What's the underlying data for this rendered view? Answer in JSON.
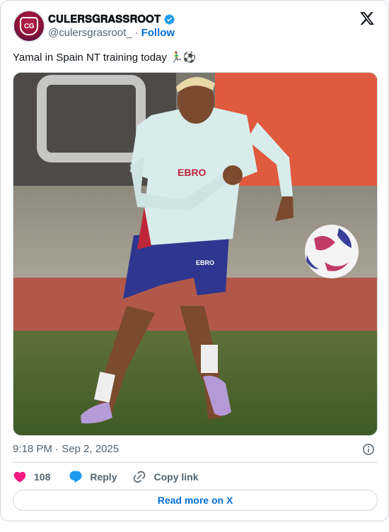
{
  "author": {
    "display_name": "𝐂𝐔𝐋𝐄𝐑𝐒𝐆𝐑𝐀𝐒𝐒𝐑𝐎𝐎𝐓",
    "avatar_text": "CG",
    "handle": "@culersgrasroot_",
    "separator": "·",
    "follow_label": "Follow",
    "verified_color": "#1d9bf0"
  },
  "tweet": {
    "text": "Yamal in Spain NT training today 🏃‍♂️⚽"
  },
  "media": {
    "shirt_text": "EBRO",
    "shorts_text": "EBRO"
  },
  "meta": {
    "timestamp": "9:18 PM · Sep 2, 2025"
  },
  "actions": {
    "like_count": "108",
    "reply_label": "Reply",
    "copy_label": "Copy link",
    "like_color": "#f91880",
    "reply_color": "#1d9bf0"
  },
  "footer": {
    "read_more_label": "Read more on X"
  }
}
